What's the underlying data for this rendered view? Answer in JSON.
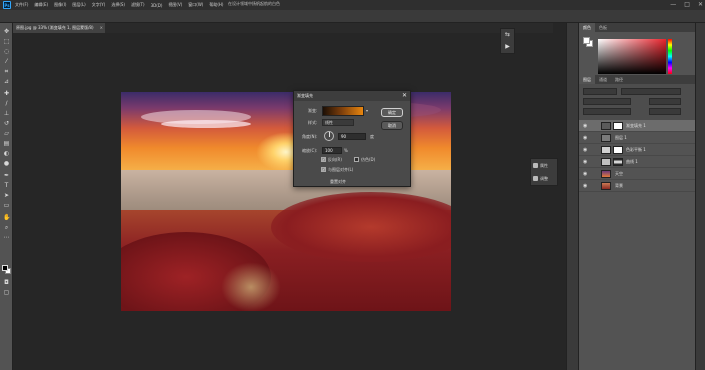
{
  "app": {
    "logo": "Ps",
    "menu": [
      "文件(F)",
      "编辑(E)",
      "图像(I)",
      "图层(L)",
      "文字(Y)",
      "选择(S)",
      "滤镜(T)",
      "3D(D)",
      "视图(V)",
      "窗口(W)",
      "帮助(H)"
    ],
    "window_title": "在设计领域中扬帆起航的白色",
    "controls": {
      "minimize": "—",
      "maximize": "□",
      "close": "✕"
    }
  },
  "document": {
    "tab_label": "原图.jpg @ 33% (渐变填充 1, 图层蒙版/8)",
    "tab_close": "×"
  },
  "dialog": {
    "title": "渐变填充",
    "close": "✕",
    "gradient_label": "渐变:",
    "gradient_arrow": "▾",
    "style_label": "样式:",
    "style_value": "线性",
    "angle_label": "角度(N):",
    "angle_value": "90",
    "angle_unit": "度",
    "scale_label": "缩放(C):",
    "scale_value": "100",
    "scale_unit": "%",
    "reverse_label": "反向(R)",
    "reverse_checked": true,
    "dither_label": "仿色(D)",
    "align_label": "与图层对齐(L)",
    "align_checked": true,
    "reset_label": "重置对齐",
    "ok_label": "确定",
    "cancel_label": "取消",
    "gradient_colors": [
      "#1c0f05",
      "#7a3d0c",
      "#e8860f"
    ]
  },
  "mini_panel": {
    "icons": [
      "history-icon",
      "play-icon"
    ],
    "glyphs": [
      "⇆",
      "▶"
    ]
  },
  "properties_panel": {
    "items": [
      {
        "label": "属性"
      },
      {
        "label": "调整"
      }
    ]
  },
  "right_panels": {
    "color_tabs": [
      "颜色",
      "色板"
    ],
    "layers_tabs": [
      "图层",
      "通道",
      "路径"
    ],
    "layers": [
      {
        "name": "渐变填充 1",
        "selected": true,
        "thumb": "#5a5a5a"
      },
      {
        "name": "图层 1",
        "selected": false,
        "thumb": "#7a7a7a"
      },
      {
        "name": "色彩平衡 1",
        "selected": false,
        "thumb": "#d0d0d0"
      },
      {
        "name": "曲线 1",
        "selected": false,
        "thumb": "#c0c0c0"
      },
      {
        "name": "天空",
        "selected": false,
        "thumb": "#c9573a"
      },
      {
        "name": "背景",
        "selected": false,
        "thumb": "#8a2a22"
      }
    ],
    "eye_glyph": "👁"
  }
}
